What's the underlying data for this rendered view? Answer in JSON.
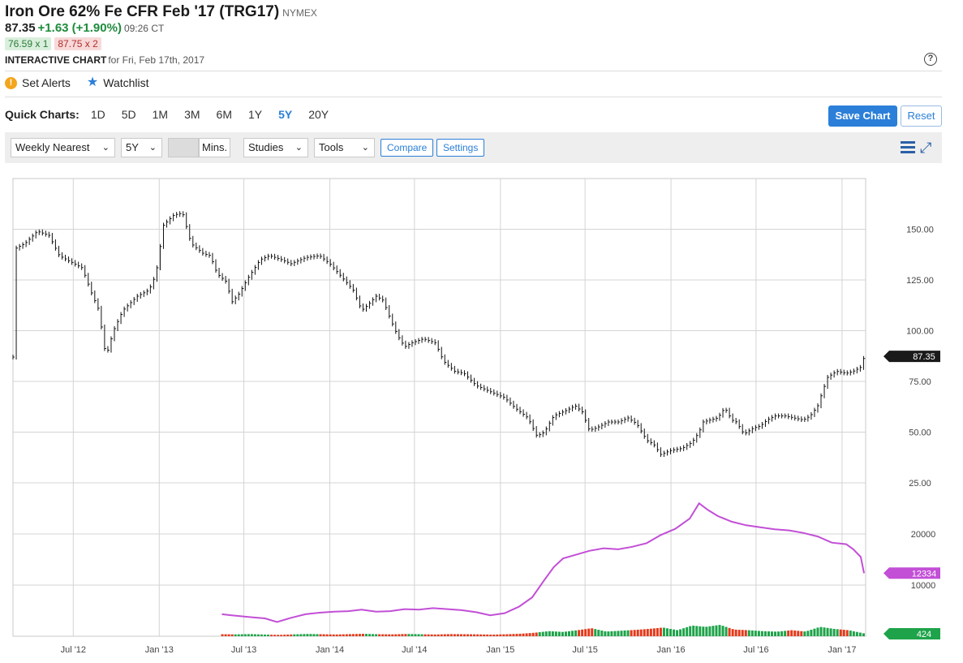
{
  "header": {
    "title": "Iron Ore 62% Fe CFR Feb '17 (TRG17)",
    "exchange": "NYMEX",
    "last": "87.35",
    "change": "+1.63 (+1.90%)",
    "time": "09:26 CT",
    "bid": "76.59 x 1",
    "ask": "87.75 x 2",
    "chart_label": "INTERACTIVE CHART",
    "chart_date": "for Fri, Feb 17th, 2017",
    "help": "?"
  },
  "actions": {
    "alerts": "Set Alerts",
    "watchlist": "Watchlist",
    "alert_icon": "!",
    "star_icon": "★"
  },
  "quick": {
    "label": "Quick Charts:",
    "items": [
      "1D",
      "5D",
      "1M",
      "3M",
      "6M",
      "1Y",
      "5Y",
      "20Y"
    ],
    "active": "5Y",
    "save": "Save Chart",
    "reset": "Reset"
  },
  "toolbar": {
    "interval": "Weekly Nearest",
    "range": "5Y",
    "mins": "Mins.",
    "studies": "Studies",
    "tools": "Tools",
    "compare": "Compare",
    "settings": "Settings"
  },
  "colors": {
    "accent": "#2b7fd8",
    "up": "#1ea34a",
    "down": "#e4391b",
    "oi_line": "#c24fd6",
    "price_badge": "#1a1a1a"
  },
  "chart_data": [
    {
      "type": "ohlc",
      "panel": "price",
      "yticks": [
        150,
        125,
        100,
        75,
        50,
        25
      ],
      "ytick_labels": [
        "150.00",
        "125.00",
        "100.00",
        "75.00",
        "50.00",
        "25.00"
      ],
      "ylim": [
        25,
        175
      ],
      "last_label": "87.35",
      "x_labels": [
        "Jul '12",
        "Jan '13",
        "Jul '13",
        "Jan '14",
        "Jul '14",
        "Jan '15",
        "Jul '15",
        "Jan '16",
        "Jul '16",
        "Jan '17"
      ],
      "x_label_dates": [
        "2012-07-01",
        "2013-01-01",
        "2013-07-01",
        "2014-01-01",
        "2014-07-01",
        "2015-01-01",
        "2015-07-01",
        "2016-01-01",
        "2016-07-01",
        "2017-01-01"
      ],
      "x_range": [
        "2012-02-23",
        "2017-02-17"
      ],
      "close_series": [
        [
          "2012-02-24",
          140
        ],
        [
          "2012-03-20",
          143
        ],
        [
          "2012-04-15",
          149
        ],
        [
          "2012-05-10",
          147
        ],
        [
          "2012-06-01",
          137
        ],
        [
          "2012-06-25",
          134
        ],
        [
          "2012-07-20",
          131
        ],
        [
          "2012-08-10",
          118
        ],
        [
          "2012-08-25",
          110
        ],
        [
          "2012-09-05",
          92
        ],
        [
          "2012-09-10",
          88
        ],
        [
          "2012-09-25",
          100
        ],
        [
          "2012-10-15",
          110
        ],
        [
          "2012-11-15",
          117
        ],
        [
          "2012-12-10",
          120
        ],
        [
          "2012-12-25",
          128
        ],
        [
          "2013-01-10",
          152
        ],
        [
          "2013-02-01",
          157
        ],
        [
          "2013-02-20",
          158
        ],
        [
          "2013-03-10",
          143
        ],
        [
          "2013-04-05",
          138
        ],
        [
          "2013-04-20",
          137
        ],
        [
          "2013-05-05",
          128
        ],
        [
          "2013-05-25",
          124
        ],
        [
          "2013-06-05",
          114
        ],
        [
          "2013-06-20",
          118
        ],
        [
          "2013-07-10",
          126
        ],
        [
          "2013-08-05",
          135
        ],
        [
          "2013-08-25",
          137
        ],
        [
          "2013-09-20",
          135
        ],
        [
          "2013-10-10",
          133
        ],
        [
          "2013-11-10",
          136
        ],
        [
          "2013-12-10",
          137
        ],
        [
          "2014-01-01",
          133
        ],
        [
          "2014-02-01",
          125
        ],
        [
          "2014-02-20",
          120
        ],
        [
          "2014-03-10",
          110
        ],
        [
          "2014-03-25",
          113
        ],
        [
          "2014-04-10",
          117
        ],
        [
          "2014-04-25",
          115
        ],
        [
          "2014-05-10",
          106
        ],
        [
          "2014-05-25",
          98
        ],
        [
          "2014-06-10",
          92
        ],
        [
          "2014-06-25",
          94
        ],
        [
          "2014-07-20",
          96
        ],
        [
          "2014-08-15",
          94
        ],
        [
          "2014-09-01",
          85
        ],
        [
          "2014-09-25",
          80
        ],
        [
          "2014-10-15",
          79
        ],
        [
          "2014-11-10",
          73
        ],
        [
          "2014-12-10",
          70
        ],
        [
          "2015-01-10",
          67
        ],
        [
          "2015-02-01",
          62
        ],
        [
          "2015-03-01",
          57
        ],
        [
          "2015-03-20",
          48
        ],
        [
          "2015-04-05",
          50
        ],
        [
          "2015-04-25",
          58
        ],
        [
          "2015-05-25",
          61
        ],
        [
          "2015-06-10",
          63
        ],
        [
          "2015-06-25",
          60
        ],
        [
          "2015-07-10",
          51
        ],
        [
          "2015-07-25",
          52
        ],
        [
          "2015-08-20",
          55
        ],
        [
          "2015-09-10",
          55
        ],
        [
          "2015-10-01",
          57
        ],
        [
          "2015-10-20",
          54
        ],
        [
          "2015-11-10",
          46
        ],
        [
          "2015-11-25",
          44
        ],
        [
          "2015-12-10",
          39
        ],
        [
          "2016-01-01",
          41
        ],
        [
          "2016-01-25",
          42
        ],
        [
          "2016-02-15",
          45
        ],
        [
          "2016-03-01",
          50
        ],
        [
          "2016-03-10",
          55
        ],
        [
          "2016-03-25",
          56
        ],
        [
          "2016-04-10",
          57
        ],
        [
          "2016-04-25",
          62
        ],
        [
          "2016-05-10",
          56
        ],
        [
          "2016-05-20",
          55
        ],
        [
          "2016-06-05",
          49
        ],
        [
          "2016-06-25",
          52
        ],
        [
          "2016-07-10",
          53
        ],
        [
          "2016-07-25",
          56
        ],
        [
          "2016-08-10",
          58
        ],
        [
          "2016-09-01",
          58
        ],
        [
          "2016-09-20",
          57
        ],
        [
          "2016-10-10",
          56
        ],
        [
          "2016-10-25",
          58
        ],
        [
          "2016-11-10",
          63
        ],
        [
          "2016-11-20",
          70
        ],
        [
          "2016-12-01",
          77
        ],
        [
          "2016-12-20",
          80
        ],
        [
          "2017-01-10",
          79
        ],
        [
          "2017-01-25",
          80
        ],
        [
          "2017-02-10",
          82
        ],
        [
          "2017-02-17",
          87
        ]
      ]
    },
    {
      "type": "line",
      "panel": "open_interest",
      "name": "",
      "yticks": [
        20000,
        10000
      ],
      "ytick_labels": [
        "20000",
        "10000"
      ],
      "ylim": [
        0,
        30000
      ],
      "last_label": "12334",
      "series": [
        [
          "2013-05-15",
          4300
        ],
        [
          "2013-06-05",
          4100
        ],
        [
          "2013-06-25",
          3900
        ],
        [
          "2013-07-20",
          3700
        ],
        [
          "2013-08-15",
          3500
        ],
        [
          "2013-09-10",
          2800
        ],
        [
          "2013-10-10",
          3600
        ],
        [
          "2013-11-10",
          4300
        ],
        [
          "2013-12-10",
          4600
        ],
        [
          "2014-01-10",
          4800
        ],
        [
          "2014-02-10",
          4900
        ],
        [
          "2014-03-10",
          5200
        ],
        [
          "2014-04-10",
          4800
        ],
        [
          "2014-05-10",
          4900
        ],
        [
          "2014-06-10",
          5300
        ],
        [
          "2014-07-10",
          5200
        ],
        [
          "2014-08-10",
          5500
        ],
        [
          "2014-09-10",
          5300
        ],
        [
          "2014-10-10",
          5100
        ],
        [
          "2014-11-10",
          4700
        ],
        [
          "2014-12-10",
          4100
        ],
        [
          "2015-01-10",
          4500
        ],
        [
          "2015-02-10",
          5800
        ],
        [
          "2015-03-10",
          7600
        ],
        [
          "2015-04-05",
          11000
        ],
        [
          "2015-04-25",
          13500
        ],
        [
          "2015-05-15",
          15200
        ],
        [
          "2015-06-10",
          15900
        ],
        [
          "2015-07-10",
          16700
        ],
        [
          "2015-08-10",
          17200
        ],
        [
          "2015-09-10",
          17000
        ],
        [
          "2015-10-10",
          17500
        ],
        [
          "2015-11-10",
          18200
        ],
        [
          "2015-12-10",
          19800
        ],
        [
          "2016-01-10",
          21000
        ],
        [
          "2016-02-10",
          23000
        ],
        [
          "2016-03-01",
          26000
        ],
        [
          "2016-03-20",
          24700
        ],
        [
          "2016-04-10",
          23500
        ],
        [
          "2016-05-10",
          22400
        ],
        [
          "2016-06-10",
          21700
        ],
        [
          "2016-07-10",
          21300
        ],
        [
          "2016-08-10",
          20900
        ],
        [
          "2016-09-10",
          20700
        ],
        [
          "2016-10-10",
          20200
        ],
        [
          "2016-11-10",
          19500
        ],
        [
          "2016-12-10",
          18300
        ],
        [
          "2017-01-10",
          18000
        ],
        [
          "2017-01-25",
          17000
        ],
        [
          "2017-02-10",
          15500
        ],
        [
          "2017-02-17",
          12334
        ]
      ]
    },
    {
      "type": "bar",
      "panel": "volume",
      "last_label": "424",
      "values": [
        [
          "2013-05-15",
          300
        ],
        [
          "2013-06-15",
          280
        ],
        [
          "2013-07-15",
          320
        ],
        [
          "2013-08-15",
          250
        ],
        [
          "2013-09-15",
          200
        ],
        [
          "2013-10-15",
          280
        ],
        [
          "2013-11-15",
          340
        ],
        [
          "2013-12-15",
          300
        ],
        [
          "2014-01-15",
          260
        ],
        [
          "2014-02-15",
          320
        ],
        [
          "2014-03-15",
          360
        ],
        [
          "2014-04-15",
          300
        ],
        [
          "2014-05-15",
          280
        ],
        [
          "2014-06-15",
          340
        ],
        [
          "2014-07-15",
          300
        ],
        [
          "2014-08-15",
          260
        ],
        [
          "2014-09-15",
          320
        ],
        [
          "2014-10-15",
          300
        ],
        [
          "2014-11-15",
          280
        ],
        [
          "2014-12-15",
          240
        ],
        [
          "2015-01-15",
          300
        ],
        [
          "2015-02-15",
          380
        ],
        [
          "2015-03-15",
          520
        ],
        [
          "2015-04-15",
          760
        ],
        [
          "2015-05-15",
          640
        ],
        [
          "2015-06-15",
          900
        ],
        [
          "2015-07-15",
          1200
        ],
        [
          "2015-08-15",
          700
        ],
        [
          "2015-09-15",
          820
        ],
        [
          "2015-10-15",
          940
        ],
        [
          "2015-11-15",
          1100
        ],
        [
          "2015-12-15",
          1300
        ],
        [
          "2016-01-15",
          900
        ],
        [
          "2016-02-15",
          1600
        ],
        [
          "2016-03-15",
          1400
        ],
        [
          "2016-04-15",
          1700
        ],
        [
          "2016-05-15",
          1000
        ],
        [
          "2016-06-15",
          900
        ],
        [
          "2016-07-15",
          760
        ],
        [
          "2016-08-15",
          680
        ],
        [
          "2016-09-15",
          900
        ],
        [
          "2016-10-15",
          700
        ],
        [
          "2016-11-15",
          1400
        ],
        [
          "2016-12-15",
          1100
        ],
        [
          "2017-01-15",
          900
        ],
        [
          "2017-02-17",
          424
        ]
      ]
    }
  ]
}
